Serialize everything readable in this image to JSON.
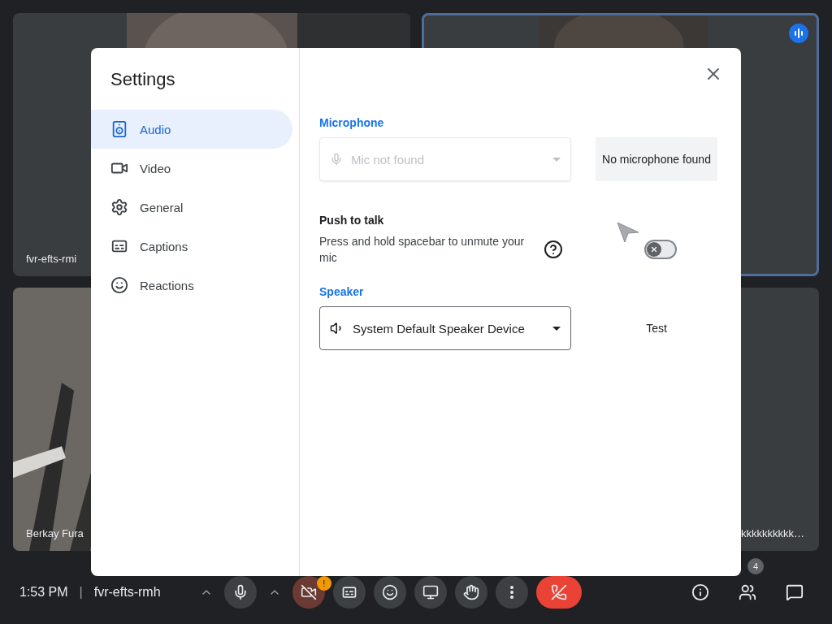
{
  "tiles": [
    {
      "name": "fvr-efts-rmi",
      "speaking": false
    },
    {
      "speaking": true
    },
    {
      "name": "Berkay Fura",
      "speaking": false
    },
    {
      "name": "kkkkkkkkkk…",
      "speaking": false
    }
  ],
  "settings": {
    "title": "Settings",
    "nav": [
      {
        "kind": "audio",
        "label": "Audio",
        "selected": true
      },
      {
        "kind": "video",
        "label": "Video",
        "selected": false
      },
      {
        "kind": "general",
        "label": "General",
        "selected": false
      },
      {
        "kind": "captions",
        "label": "Captions",
        "selected": false
      },
      {
        "kind": "reactions",
        "label": "Reactions",
        "selected": false
      }
    ],
    "microphone": {
      "heading": "Microphone",
      "placeholder": "Mic not found",
      "disabled": true,
      "status": "No microphone found"
    },
    "push_to_talk": {
      "title": "Push to talk",
      "description": "Press and hold spacebar to unmute your mic",
      "on": false
    },
    "speaker": {
      "heading": "Speaker",
      "value": "System Default Speaker Device",
      "test": "Test"
    }
  },
  "bottom_bar": {
    "time": "1:53 PM",
    "separator": "|",
    "meeting_code": "fvr-efts-rmh",
    "participants_badge": "4",
    "camera_alert": "!"
  }
}
